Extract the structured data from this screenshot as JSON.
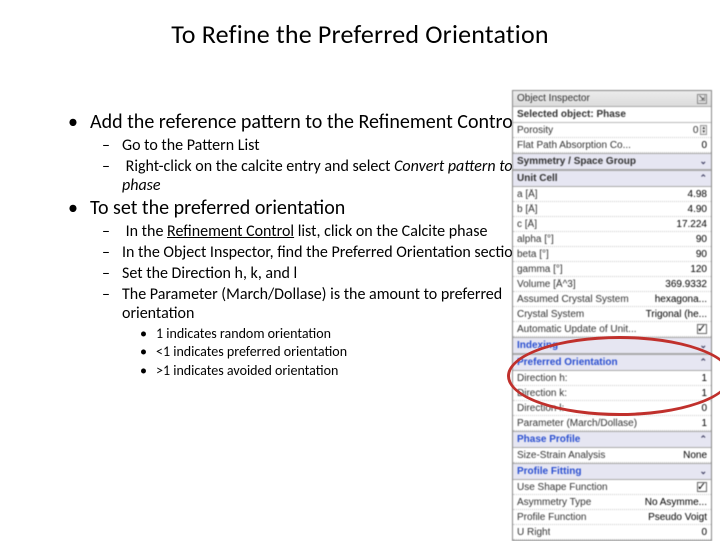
{
  "title": "To Refine the Preferred Orientation",
  "bullets": {
    "b1": "Add the reference pattern to the Refinement Control",
    "b1a": "Go to the Pattern List",
    "b1b_pre": "Right-click on the calcite entry and select ",
    "b1b_ital": "Convert pattern to phase",
    "b2": "To set the preferred orientation",
    "b2a_pre": "In the ",
    "b2a_ul": "Refinement Control",
    "b2a_post": " list, click on the Calcite phase",
    "b2b": "In the Object Inspector, find the Preferred Orientation section",
    "b2c": "Set the Direction h, k, and l",
    "b2d": "The Parameter (March/Dollase) is the amount to preferred orientation",
    "b2d1": "1 indicates random orientation",
    "b2d2": "<1 indicates preferred orientation",
    "b2d3": ">1 indicates avoided orientation"
  },
  "panel": {
    "header": "Object Inspector",
    "selected_label": "Selected object: Phase",
    "rows_top": [
      {
        "k": "Porosity",
        "v": "0"
      },
      {
        "k": "Flat Path Absorption Co...",
        "v": "0"
      }
    ],
    "sec_sym": "Symmetry / Space Group",
    "sec_unit": "Unit Cell",
    "unit_rows": [
      {
        "k": "a [Å]",
        "v": "4.98"
      },
      {
        "k": "b [Å]",
        "v": "4.90"
      },
      {
        "k": "c [Å]",
        "v": "17.224"
      },
      {
        "k": "alpha [°]",
        "v": "90"
      },
      {
        "k": "beta [°]",
        "v": "90"
      },
      {
        "k": "gamma [°]",
        "v": "120"
      },
      {
        "k": "Volume [Å^3]",
        "v": "369.9332"
      },
      {
        "k": "Assumed Crystal System",
        "v": "hexagona..."
      },
      {
        "k": "Crystal System",
        "v": "Trigonal (he..."
      },
      {
        "k": "Automatic Update of Unit...",
        "v": "check"
      }
    ],
    "sec_index": "Indexing",
    "sec_pref": "Preferred Orientation",
    "pref_rows": [
      {
        "k": "Direction h:",
        "v": "1"
      },
      {
        "k": "Direction k:",
        "v": "1"
      },
      {
        "k": "Direction l:",
        "v": "0"
      },
      {
        "k": "Parameter (March/Dollase)",
        "v": "1"
      }
    ],
    "sec_phase": "Phase Profile",
    "phase_row": {
      "k": "Size-Strain Analysis",
      "v": "None"
    },
    "sec_fit": "Profile Fitting",
    "fit_rows": [
      {
        "k": "Use Shape Function",
        "v": "check"
      },
      {
        "k": "Asymmetry Type",
        "v": "No Asymme..."
      },
      {
        "k": "Profile Function",
        "v": "Pseudo Voigt"
      },
      {
        "k": "U Right",
        "v": "0"
      }
    ]
  }
}
